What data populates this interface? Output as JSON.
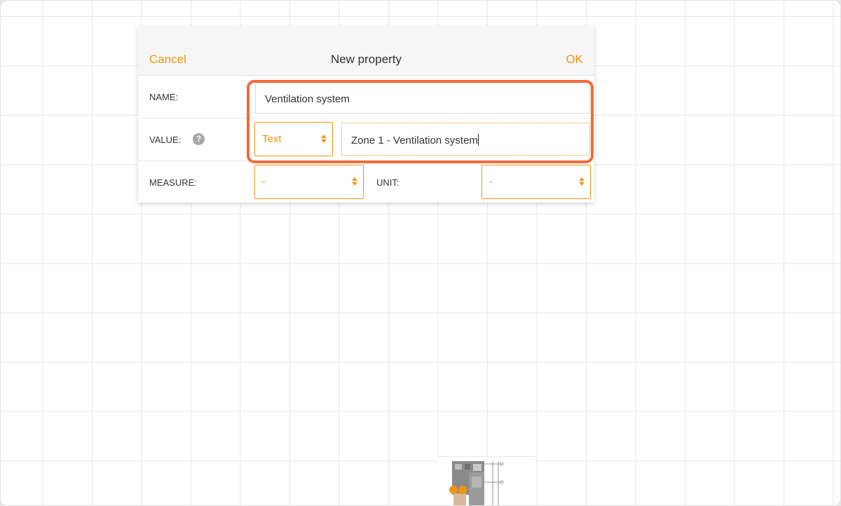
{
  "dialog": {
    "title": "New property",
    "cancel_label": "Cancel",
    "ok_label": "OK"
  },
  "form": {
    "name_label": "NAME:",
    "name_value": "Ventilation system",
    "value_label": "VALUE:",
    "value_type": "Text",
    "value_text": "Zone 1 - Ventilation system",
    "measure_label": "MEASURE:",
    "measure_value": "-",
    "unit_label": "UNIT:",
    "unit_value": "-"
  },
  "icons": {
    "help": "help-icon",
    "select_arrows": "updown-arrows-icon"
  },
  "colors": {
    "accent": "#f0950e",
    "highlight": "#f46a39",
    "grid": "#e6e6e6"
  }
}
